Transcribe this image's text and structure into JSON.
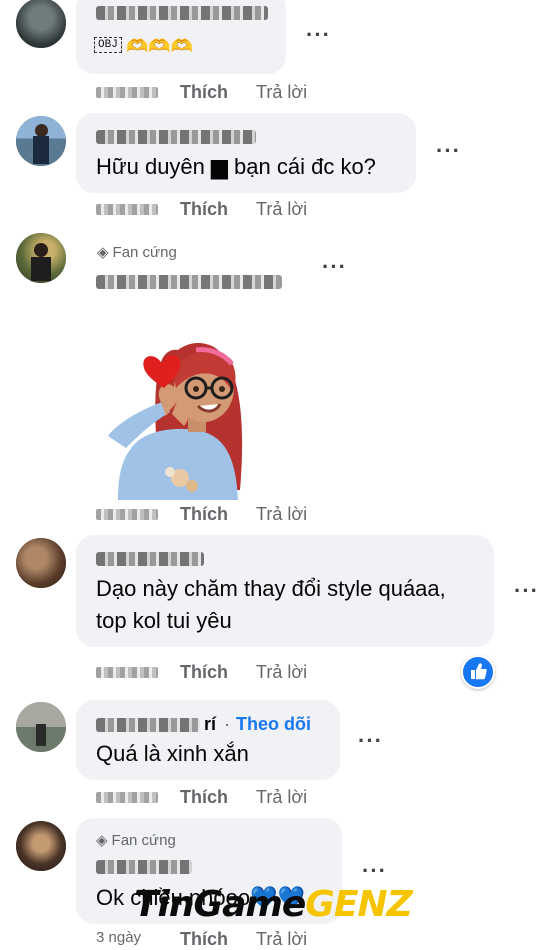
{
  "comments": [
    {
      "obj_label": "OBJ",
      "heart_emojis": "🫶🫶🫶",
      "like": "Thích",
      "reply": "Trả lời"
    },
    {
      "text": "Hữu duyên ▆ bạn cái đc ko?",
      "like": "Thích",
      "reply": "Trả lời"
    },
    {
      "badge": "Fan cứng",
      "like": "Thích",
      "reply": "Trả lời"
    },
    {
      "text_line1": "Dạo này chăm thay đổi style quáaa,",
      "text_line2": "top kol tui yêu",
      "like": "Thích",
      "reply": "Trả lời"
    },
    {
      "name_suffix": "rí",
      "follow": "Theo dõi",
      "text": "Quá là xinh xắn",
      "like": "Thích",
      "reply": "Trả lời"
    },
    {
      "badge": "Fan cứng",
      "text": "Ok chiều nhóoo💙💙",
      "time": "3 ngày",
      "like": "Thích",
      "reply": "Trả lời"
    }
  ],
  "icons": {
    "more": "more-options-icon",
    "gem": "gem-icon",
    "like_reaction": "like-reaction-icon"
  },
  "watermark": {
    "part1": "TinGame",
    "part2": "GENZ"
  },
  "colors": {
    "bubble": "#f0f2f5",
    "link_blue": "#1877f2",
    "meta_gray": "#65676b",
    "watermark_yellow": "#f7c400"
  }
}
